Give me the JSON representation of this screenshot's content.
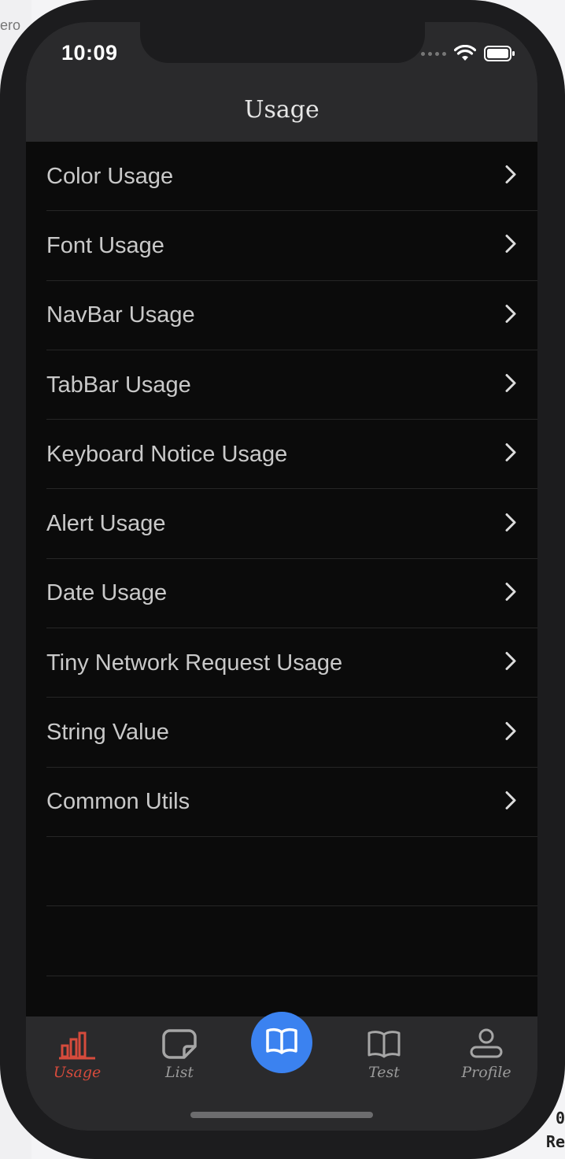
{
  "status_bar": {
    "time": "10:09"
  },
  "nav": {
    "title": "Usage"
  },
  "list": {
    "items": [
      {
        "label": "Color Usage"
      },
      {
        "label": "Font Usage"
      },
      {
        "label": "NavBar Usage"
      },
      {
        "label": "TabBar Usage"
      },
      {
        "label": "Keyboard Notice Usage"
      },
      {
        "label": "Alert Usage"
      },
      {
        "label": "Date Usage"
      },
      {
        "label": "Tiny Network Request Usage"
      },
      {
        "label": "String Value"
      },
      {
        "label": "Common Utils"
      }
    ]
  },
  "tabbar": {
    "tabs": [
      {
        "label": "Usage",
        "icon": "bar-chart-icon",
        "active": true
      },
      {
        "label": "List",
        "icon": "note-icon",
        "active": false
      },
      {
        "label": "",
        "icon": "open-book-icon",
        "active": false
      },
      {
        "label": "Test",
        "icon": "book-outline-icon",
        "active": false
      },
      {
        "label": "Profile",
        "icon": "person-icon",
        "active": false
      }
    ]
  },
  "background": {
    "frag_top": "ero",
    "frag_br1": "0",
    "frag_br2": "Re"
  },
  "colors": {
    "active_tab": "#d64b3c",
    "center_button": "#3b82f0",
    "bar_background": "#2a2a2c",
    "list_background": "#0b0b0b"
  }
}
